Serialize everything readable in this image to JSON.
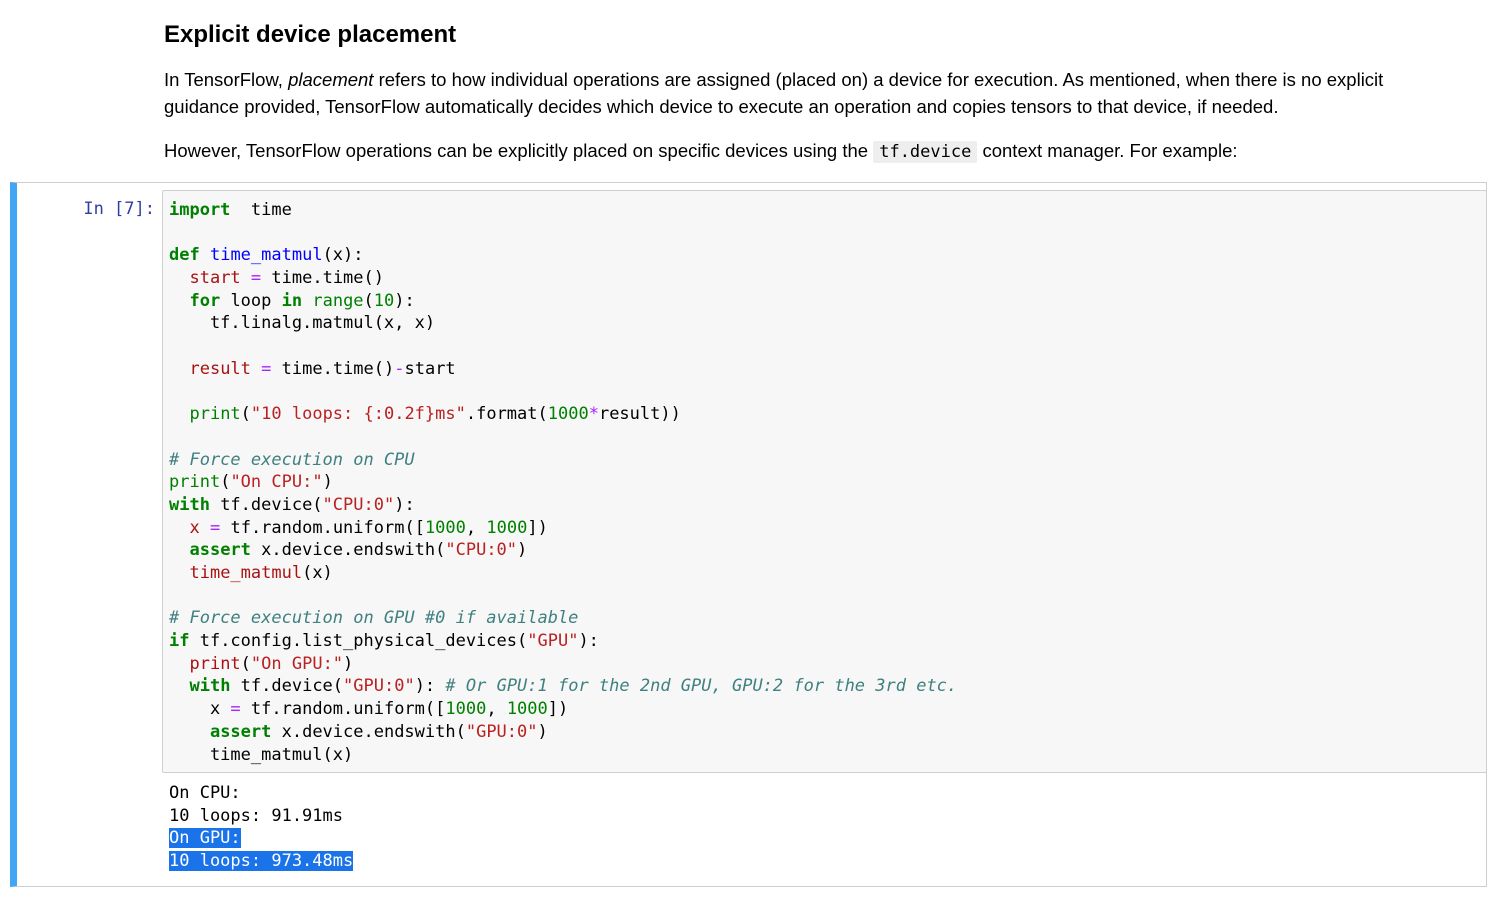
{
  "markdown": {
    "heading": "Explicit device placement",
    "p1_before": "In TensorFlow, ",
    "p1_em": "placement",
    "p1_after": " refers to how individual operations are assigned (placed on) a device for execution. As mentioned, when there is no explicit guidance provided, TensorFlow automatically decides which device to execute an operation and copies tensors to that device, if needed.",
    "p2_before": "However, TensorFlow operations can be explicitly placed on specific devices using the ",
    "p2_code": "tf.device",
    "p2_after": " context manager. For example:"
  },
  "cell": {
    "prompt": "In [7]:",
    "code_lines": [
      [
        [
          "kw",
          "import"
        ],
        [
          "",
          "  time"
        ]
      ],
      [],
      [
        [
          "kw",
          "def"
        ],
        [
          "",
          " "
        ],
        [
          "fn",
          "time_matmul"
        ],
        [
          "",
          "(x):"
        ]
      ],
      [
        [
          "",
          "  "
        ],
        [
          "var",
          "start"
        ],
        [
          "",
          " "
        ],
        [
          "op",
          "="
        ],
        [
          "",
          " time.time()"
        ]
      ],
      [
        [
          "",
          "  "
        ],
        [
          "kw",
          "for"
        ],
        [
          "",
          " loop "
        ],
        [
          "kw",
          "in"
        ],
        [
          "",
          " "
        ],
        [
          "bi",
          "range"
        ],
        [
          "",
          "("
        ],
        [
          "num",
          "10"
        ],
        [
          "",
          "):"
        ]
      ],
      [
        [
          "",
          "    tf.linalg.matmul(x, x)"
        ]
      ],
      [],
      [
        [
          "",
          "  "
        ],
        [
          "var",
          "result"
        ],
        [
          "",
          " "
        ],
        [
          "op",
          "="
        ],
        [
          "",
          " time.time()"
        ],
        [
          "op",
          "-"
        ],
        [
          "",
          "start"
        ]
      ],
      [],
      [
        [
          "",
          "  "
        ],
        [
          "bi",
          "print"
        ],
        [
          "",
          "("
        ],
        [
          "str",
          "\"10 loops: {:0.2f}ms\""
        ],
        [
          "",
          ".format("
        ],
        [
          "num",
          "1000"
        ],
        [
          "op",
          "*"
        ],
        [
          "",
          "result))"
        ]
      ],
      [],
      [
        [
          "cm",
          "# Force execution on CPU"
        ]
      ],
      [
        [
          "bi",
          "print"
        ],
        [
          "",
          "("
        ],
        [
          "str",
          "\"On CPU:\""
        ],
        [
          "",
          ")"
        ]
      ],
      [
        [
          "kw",
          "with"
        ],
        [
          "",
          " tf.device("
        ],
        [
          "str",
          "\"CPU:0\""
        ],
        [
          "",
          "):"
        ]
      ],
      [
        [
          "",
          "  "
        ],
        [
          "var",
          "x"
        ],
        [
          "",
          " "
        ],
        [
          "op",
          "="
        ],
        [
          "",
          " tf.random.uniform(["
        ],
        [
          "num",
          "1000"
        ],
        [
          "",
          ", "
        ],
        [
          "num",
          "1000"
        ],
        [
          "",
          "])"
        ]
      ],
      [
        [
          "",
          "  "
        ],
        [
          "kw",
          "assert"
        ],
        [
          "",
          " x.device.endswith("
        ],
        [
          "str",
          "\"CPU:0\""
        ],
        [
          "",
          ")"
        ]
      ],
      [
        [
          "",
          "  "
        ],
        [
          "var",
          "time_matmul"
        ],
        [
          "",
          "(x)"
        ]
      ],
      [],
      [
        [
          "cm",
          "# Force execution on GPU #0 if available"
        ]
      ],
      [
        [
          "kw",
          "if"
        ],
        [
          "",
          " tf.config.list_physical_devices("
        ],
        [
          "str",
          "\"GPU\""
        ],
        [
          "",
          "):"
        ]
      ],
      [
        [
          "",
          "  "
        ],
        [
          "var",
          "print"
        ],
        [
          "",
          "("
        ],
        [
          "str",
          "\"On GPU:\""
        ],
        [
          "",
          ")"
        ]
      ],
      [
        [
          "",
          "  "
        ],
        [
          "kw",
          "with"
        ],
        [
          "",
          " tf.device("
        ],
        [
          "str",
          "\"GPU:0\""
        ],
        [
          "",
          "): "
        ],
        [
          "cm",
          "# Or GPU:1 for the 2nd GPU, GPU:2 for the 3rd etc."
        ]
      ],
      [
        [
          "",
          "    x "
        ],
        [
          "op",
          "="
        ],
        [
          "",
          " tf.random.uniform(["
        ],
        [
          "num",
          "1000"
        ],
        [
          "",
          ", "
        ],
        [
          "num",
          "1000"
        ],
        [
          "",
          "])"
        ]
      ],
      [
        [
          "",
          "    "
        ],
        [
          "kw",
          "assert"
        ],
        [
          "",
          " x.device.endswith("
        ],
        [
          "str",
          "\"GPU:0\""
        ],
        [
          "",
          ")"
        ]
      ],
      [
        [
          "",
          "    time_matmul(x)"
        ]
      ]
    ],
    "output_lines": [
      {
        "text": "On CPU:",
        "selected": false
      },
      {
        "text": "10 loops: 91.91ms",
        "selected": false
      },
      {
        "text": "On GPU:",
        "selected": true
      },
      {
        "text": "10 loops: 973.48ms",
        "selected": true
      }
    ],
    "colors": {
      "cell_selected_bar": "#42a5f5",
      "prompt": "#303f9f",
      "selection": "#1a73e8"
    }
  }
}
